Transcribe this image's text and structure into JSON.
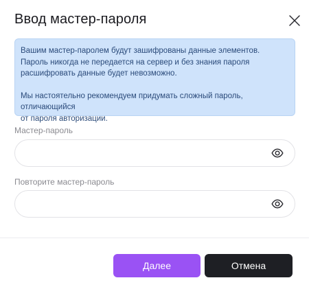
{
  "dialog": {
    "title": "Ввод мастер-пароля"
  },
  "info": {
    "line1": "Вашим мастер-паролем будут зашифрованы данные элементов.",
    "line2": "Пароль никогда не передается на сервер и без знания пароля",
    "line3": "расшифровать данные будет невозможно.",
    "line4": "Мы настоятельно рекомендуем придумать сложный пароль, отличающийся",
    "line5": "от пароля авторизации."
  },
  "fields": {
    "password_label": "Мастер-пароль",
    "password_value": "",
    "repeat_label": "Повторите мастер-пароль",
    "repeat_value": ""
  },
  "icons": {
    "close": "close-icon",
    "eye": "eye-icon"
  },
  "buttons": {
    "next_label": "Далее",
    "cancel_label": "Отмена"
  },
  "colors": {
    "accent": "#9a52f4",
    "cancel": "#1e1f24",
    "info_bg": "#cfe3fb",
    "info_text": "#2a4a7a"
  }
}
